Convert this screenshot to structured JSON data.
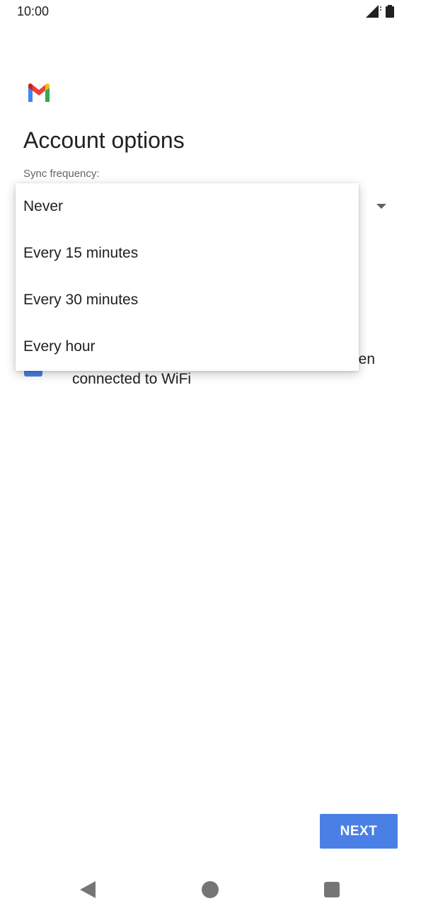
{
  "status_bar": {
    "time": "10:00",
    "icons": [
      "signal-icon",
      "battery-icon"
    ]
  },
  "app": {
    "logo": "gmail-logo",
    "title": "Account options",
    "sync_label": "Sync frequency:"
  },
  "menu": {
    "items": [
      {
        "label": "Never"
      },
      {
        "label": "Every 15 minutes"
      },
      {
        "label": "Every 30 minutes"
      },
      {
        "label": "Every hour"
      }
    ]
  },
  "background_option": {
    "line1_visible": "en",
    "line2": "connected to WiFi"
  },
  "footer": {
    "next_label": "NEXT"
  },
  "colors": {
    "accent": "#4a80e6",
    "text": "#202124",
    "secondary_text": "#5f6368",
    "nav": "#757575"
  },
  "nav_bar": {
    "icons": [
      "back-icon",
      "home-icon",
      "recents-icon"
    ]
  }
}
